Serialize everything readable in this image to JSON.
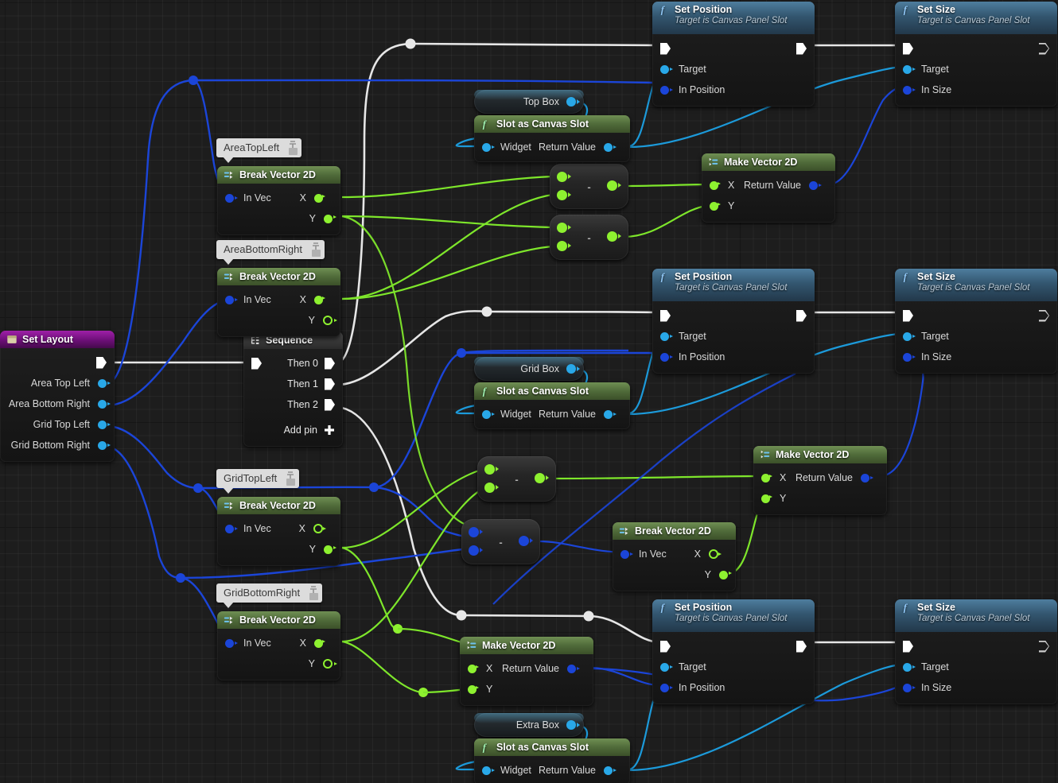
{
  "app": {
    "kind": "unreal-blueprint-graph",
    "grid_background": "#1d1d1d"
  },
  "colors": {
    "exec_wire": "#e8e8e8",
    "object_wire": "#1c9ada",
    "vector_wire": "#1b45d8",
    "float_wire": "#7ee62b",
    "pure_header": "#55703c",
    "function_header": "#3a6381",
    "event_header": "#8a1b95",
    "sequence_header": "#3d3d3d",
    "pin_object": "#29a8e8",
    "pin_vector": "#1b45d8",
    "pin_float": "#8ef130"
  },
  "nodes": {
    "set_layout": {
      "title": "Set Layout",
      "icon": "event-node-icon",
      "outputs": [
        "Area Top Left",
        "Area Bottom Right",
        "Grid Top Left",
        "Grid Bottom Right"
      ]
    },
    "sequence": {
      "title": "Sequence",
      "icon": "sequence-icon",
      "outputs": [
        "Then 0",
        "Then 1",
        "Then 2"
      ],
      "add_pin": "Add pin"
    },
    "break_area_top_left": {
      "comment": "AreaTopLeft",
      "title": "Break Vector 2D",
      "icon": "break-struct-icon",
      "input": "In Vec",
      "outputs": [
        "X",
        "Y"
      ]
    },
    "break_area_bottom_right": {
      "comment": "AreaBottomRight",
      "title": "Break Vector 2D",
      "icon": "break-struct-icon",
      "input": "In Vec",
      "outputs": [
        "X",
        "Y"
      ]
    },
    "break_grid_top_left": {
      "comment": "GridTopLeft",
      "title": "Break Vector 2D",
      "icon": "break-struct-icon",
      "input": "In Vec",
      "outputs": [
        "X",
        "Y"
      ]
    },
    "break_grid_bottom_right": {
      "comment": "GridBottomRight",
      "title": "Break Vector 2D",
      "icon": "break-struct-icon",
      "input": "In Vec",
      "outputs": [
        "X",
        "Y"
      ]
    },
    "break_vector_mid": {
      "title": "Break Vector 2D",
      "icon": "break-struct-icon",
      "input": "In Vec",
      "outputs": [
        "X",
        "Y"
      ]
    },
    "subtract_1": {
      "operator": "-"
    },
    "subtract_2": {
      "operator": "-"
    },
    "subtract_3": {
      "operator": "-"
    },
    "subtract_4": {
      "operator": "-"
    },
    "make_vector_top": {
      "title": "Make Vector 2D",
      "icon": "make-struct-icon",
      "inputs": [
        "X",
        "Y"
      ],
      "output": "Return Value"
    },
    "make_vector_mid": {
      "title": "Make Vector 2D",
      "icon": "make-struct-icon",
      "inputs": [
        "X",
        "Y"
      ],
      "output": "Return Value"
    },
    "make_vector_bottom": {
      "title": "Make Vector 2D",
      "icon": "make-struct-icon",
      "inputs": [
        "X",
        "Y"
      ],
      "output": "Return Value"
    },
    "top_box": {
      "label": "Top Box"
    },
    "grid_box": {
      "label": "Grid Box"
    },
    "extra_box": {
      "label": "Extra Box"
    },
    "slot_as_canvas_slot_1": {
      "title": "Slot as Canvas Slot",
      "icon": "function-f-icon",
      "input": "Widget",
      "output": "Return Value"
    },
    "slot_as_canvas_slot_2": {
      "title": "Slot as Canvas Slot",
      "icon": "function-f-icon",
      "input": "Widget",
      "output": "Return Value"
    },
    "slot_as_canvas_slot_3": {
      "title": "Slot as Canvas Slot",
      "icon": "function-f-icon",
      "input": "Widget",
      "output": "Return Value"
    },
    "set_position_1": {
      "title": "Set Position",
      "subtitle": "Target is Canvas Panel Slot",
      "icon": "function-f-icon",
      "inputs": [
        "Target",
        "In Position"
      ]
    },
    "set_position_2": {
      "title": "Set Position",
      "subtitle": "Target is Canvas Panel Slot",
      "icon": "function-f-icon",
      "inputs": [
        "Target",
        "In Position"
      ]
    },
    "set_position_3": {
      "title": "Set Position",
      "subtitle": "Target is Canvas Panel Slot",
      "icon": "function-f-icon",
      "inputs": [
        "Target",
        "In Position"
      ]
    },
    "set_size_1": {
      "title": "Set Size",
      "subtitle": "Target is Canvas Panel Slot",
      "icon": "function-f-icon",
      "inputs": [
        "Target",
        "In Size"
      ]
    },
    "set_size_2": {
      "title": "Set Size",
      "subtitle": "Target is Canvas Panel Slot",
      "icon": "function-f-icon",
      "inputs": [
        "Target",
        "In Size"
      ]
    },
    "set_size_3": {
      "title": "Set Size",
      "subtitle": "Target is Canvas Panel Slot",
      "icon": "function-f-icon",
      "inputs": [
        "Target",
        "In Size"
      ]
    }
  }
}
